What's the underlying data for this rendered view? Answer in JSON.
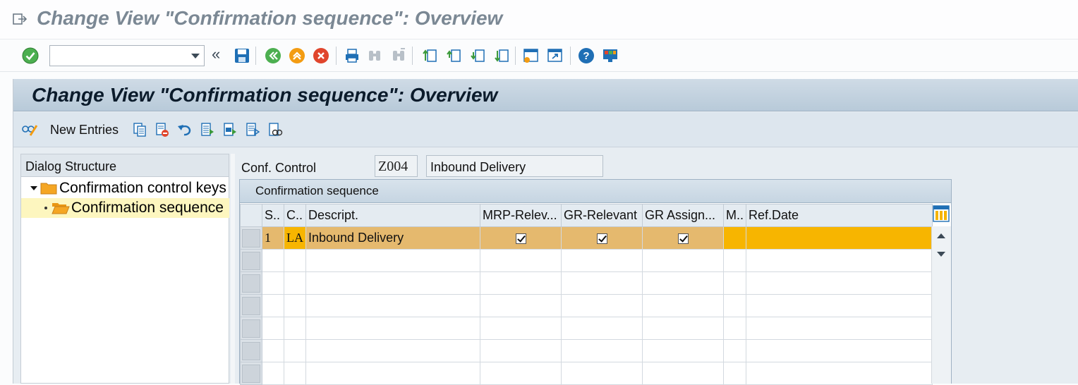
{
  "window": {
    "title": "Change View \"Confirmation sequence\": Overview"
  },
  "system_toolbar": {
    "command_field": {
      "value": "",
      "placeholder": ""
    },
    "icons": [
      "enter-icon",
      "save-icon",
      "back-icon",
      "exit-icon",
      "cancel-icon",
      "print-icon",
      "find-icon",
      "find-next-icon",
      "first-page-icon",
      "previous-page-icon",
      "next-page-icon",
      "last-page-icon",
      "create-session-icon",
      "shortcut-icon",
      "help-icon",
      "customize-layout-icon"
    ]
  },
  "screen_header": {
    "title": "Change View \"Confirmation sequence\": Overview"
  },
  "app_toolbar": {
    "new_entries_label": "New Entries"
  },
  "dialog_structure": {
    "header": "Dialog Structure",
    "items": [
      {
        "label": "Confirmation control keys",
        "level": 0,
        "expanded": true,
        "selected": false
      },
      {
        "label": "Confirmation sequence",
        "level": 1,
        "expanded": false,
        "selected": true
      }
    ]
  },
  "conf_control": {
    "label": "Conf. Control",
    "code": "Z004",
    "description": "Inbound Delivery"
  },
  "table": {
    "caption": "Confirmation sequence",
    "columns": [
      "S..",
      "C..",
      "Descript.",
      "MRP-Relev...",
      "GR-Relevant",
      "GR Assign...",
      "M..",
      "Ref.Date"
    ],
    "rows": [
      {
        "seq": "1",
        "cat": "LA",
        "descript": "Inbound Delivery",
        "mrp_relevant": true,
        "gr_relevant": true,
        "gr_assign": true,
        "m": "",
        "ref_date": ""
      }
    ],
    "empty_rows": 6
  },
  "colors": {
    "selected_row": "#e5b96e",
    "editable_cell": "#f7b500",
    "header_band": "#c3d3e0",
    "tree_selection": "#fdf6bf"
  }
}
